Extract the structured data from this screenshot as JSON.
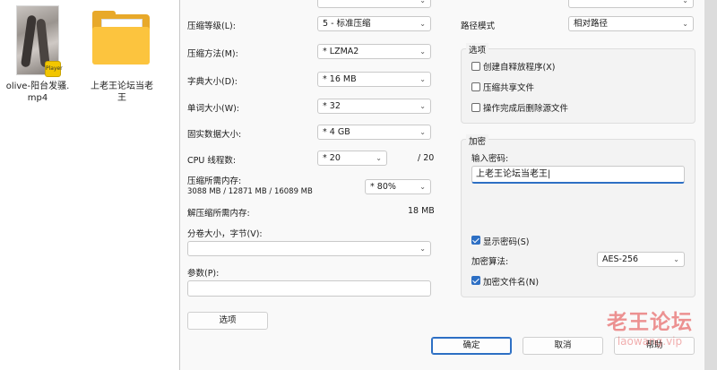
{
  "desktop": {
    "video_file": {
      "name_line1": "olive-阳台发骚.",
      "name_line2": "mp4",
      "badge": "Player"
    },
    "folder": {
      "name_line1": "上老王论坛当老",
      "name_line2": "王"
    }
  },
  "dialog": {
    "left": {
      "level": {
        "label": "压缩等级(L):",
        "value": "5 - 标准压缩"
      },
      "method": {
        "label": "压缩方法(M):",
        "value": "* LZMA2"
      },
      "dict": {
        "label": "字典大小(D):",
        "value": "* 16 MB"
      },
      "word": {
        "label": "单词大小(W):",
        "value": "* 32"
      },
      "solid": {
        "label": "固实数据大小:",
        "value": "* 4 GB"
      },
      "threads": {
        "label": "CPU 线程数:",
        "value": "* 20",
        "max": "/ 20"
      },
      "mem_compress": {
        "label": "压缩所需内存:",
        "detail": "3088 MB / 12871 MB / 16089 MB",
        "value": "* 80%"
      },
      "mem_decompress": {
        "label": "解压缩所需内存:",
        "value": "18 MB"
      },
      "volume": {
        "label": "分卷大小，字节(V):",
        "value": ""
      },
      "params": {
        "label": "参数(P):",
        "value": ""
      },
      "options_button": "选项"
    },
    "right": {
      "path_mode": {
        "label": "路径模式",
        "value": "相对路径"
      },
      "options_group": {
        "title": "选项",
        "items": [
          {
            "label": "创建自释放程序(X)",
            "checked": false
          },
          {
            "label": "压缩共享文件",
            "checked": false
          },
          {
            "label": "操作完成后删除源文件",
            "checked": false
          }
        ]
      },
      "encryption": {
        "title": "加密",
        "password_label": "输入密码:",
        "password_value": "上老王论坛当老王|",
        "show_password": {
          "label": "显示密码(S)",
          "checked": true
        },
        "algorithm_label": "加密算法:",
        "algorithm_value": "AES-256",
        "encrypt_names": {
          "label": "加密文件名(N)",
          "checked": true
        }
      }
    },
    "buttons": {
      "ok": "确定",
      "cancel": "取消",
      "help": "帮助"
    }
  },
  "watermark": {
    "line1": "老王论坛",
    "line2": "laowang.vip"
  },
  "colors": {
    "accent": "#2d6fc4",
    "watermark": "#e23d3d",
    "folder": "#fcc43e"
  }
}
